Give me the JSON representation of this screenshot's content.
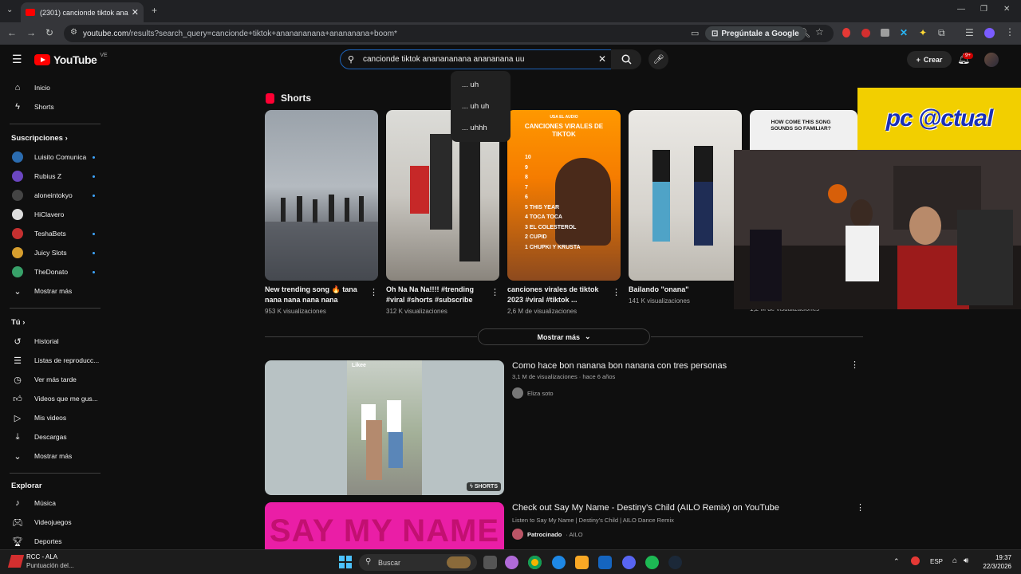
{
  "browser": {
    "tab_title": "(2301) cancionde tiktok ananan",
    "url_host": "youtube.com",
    "url_path": "/results?search_query=cancionde+tiktok+ananananana+anananana+boom*",
    "google_button": "Pregúntale a Google",
    "window_controls": [
      "—",
      "❐",
      "✕"
    ]
  },
  "header": {
    "logo": "YouTube",
    "country": "VE",
    "search_value": "cancionde tiktok ananananana anananana uu",
    "create": "Crear",
    "notif_count": "9+"
  },
  "suggestions": [
    "... uh",
    "... uh uh",
    "... uhhh"
  ],
  "sidebar": {
    "top": [
      {
        "label": "Inicio",
        "icon": "home-icon"
      },
      {
        "label": "Shorts",
        "icon": "shorts-icon"
      }
    ],
    "subs_heading": "Suscripciones",
    "subs": [
      {
        "label": "Luisito Comunica",
        "dot": true,
        "color": "#2b6cb0"
      },
      {
        "label": "Rubius Z",
        "dot": true,
        "color": "#6b46c1"
      },
      {
        "label": "aloneintokyo",
        "dot": true,
        "color": "#444444"
      },
      {
        "label": "HiClavero",
        "dot": false,
        "color": "#dddddd"
      },
      {
        "label": "TeshaBets",
        "dot": true,
        "color": "#c53030"
      },
      {
        "label": "Juicy Slots",
        "dot": true,
        "color": "#d69e2e"
      },
      {
        "label": "TheDonato",
        "dot": true,
        "color": "#38a169"
      }
    ],
    "subs_more": "Mostrar más",
    "you_heading": "Tú",
    "you": [
      {
        "label": "Historial",
        "icon": "history-icon"
      },
      {
        "label": "Listas de reproducc...",
        "icon": "playlist-icon"
      },
      {
        "label": "Ver más tarde",
        "icon": "watch-later-icon"
      },
      {
        "label": "Videos que me gus...",
        "icon": "like-icon"
      },
      {
        "label": "Mis videos",
        "icon": "my-videos-icon"
      },
      {
        "label": "Descargas",
        "icon": "download-icon"
      },
      {
        "label": "Mostrar más",
        "icon": "chevron-down-icon"
      }
    ],
    "explore_heading": "Explorar",
    "explore": [
      {
        "label": "Música",
        "icon": "music-icon"
      },
      {
        "label": "Videojuegos",
        "icon": "gaming-icon"
      },
      {
        "label": "Deportes",
        "icon": "sports-icon"
      }
    ]
  },
  "shorts": {
    "heading": "Shorts",
    "items": [
      {
        "title": "New trending song 🔥 tana nana nana nana nana",
        "views": "953 K visualizaciones"
      },
      {
        "title": "Oh Na Na Na!!!! #trending #viral #shorts #subscribe",
        "views": "312 K visualizaciones"
      },
      {
        "title": "canciones virales de tiktok 2023 #viral #tiktok ...",
        "views": "2,6 M de visualizaciones",
        "overlay_top": "USA EL AUDIO",
        "overlay_title": "CANCIONES VIRALES DE TIKTOK",
        "list": [
          "10",
          "9",
          "8",
          "7",
          "6",
          "5 THIS YEAR",
          "4 TOCA TOCA",
          "3 EL COLESTEROL",
          "2 CUPID",
          "1 CHUPKI Y KRUSTA"
        ]
      },
      {
        "title": "Bailando \"onana\"",
        "views": "141 K visualizaciones"
      },
      {
        "title": "",
        "views": "1,2 M de visualizaciones",
        "overlay_title": "HOW COME THIS SONG SOUNDS SO FAMILIAR?"
      }
    ],
    "show_more": "Mostrar más"
  },
  "videos": [
    {
      "title": "Como hace bon nanana bon nanana con tres personas",
      "meta": "3,1 M de visualizaciones · hace 6 años",
      "channel": "Eliza soto",
      "badge": "SHORTS",
      "watermark": "Likee"
    },
    {
      "title": "Check out Say My Name - Destiny's Child (AILO Remix) on YouTube",
      "meta": "Listen to Say My Name | Destiny's Child | AILO Dance Remix",
      "channel": "Patrocinado",
      "channel_suffix": "· AILO",
      "thumb_text": "SAY MY NAME"
    }
  ],
  "overlay_banner": "pc @ctual",
  "taskbar": {
    "app_title": "RCC - ALA",
    "app_sub": "Puntuación del...",
    "search": "Buscar",
    "lang": "ESP",
    "time": "19:37",
    "date": "22/3/2026"
  }
}
